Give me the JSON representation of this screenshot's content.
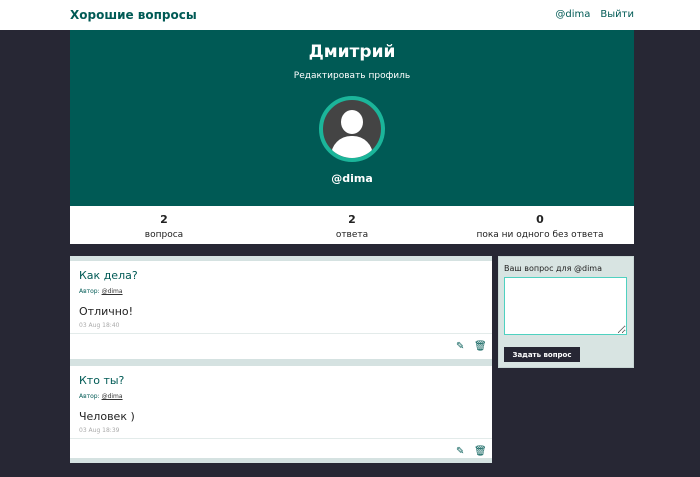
{
  "header": {
    "brand": "Хорошие вопросы",
    "user_link": "@dima",
    "logout": "Выйти"
  },
  "profile": {
    "name": "Дмитрий",
    "edit": "Редактировать профиль",
    "nickname": "@dima"
  },
  "stats": [
    {
      "n": "2",
      "l": "вопроса"
    },
    {
      "n": "2",
      "l": "ответа"
    },
    {
      "n": "0",
      "l": "пока ни одного без ответа"
    }
  ],
  "questions": [
    {
      "title": "Как дела?",
      "author_label": "Автор:",
      "author": "@dima",
      "answer": "Отлично!",
      "date": "03 Aug 18:40"
    },
    {
      "title": "Кто ты?",
      "author_label": "Автор:",
      "author": "@dima",
      "answer": "Человек )",
      "date": "03 Aug 18:39"
    }
  ],
  "ask": {
    "label": "Ваш вопрос для @dima",
    "button": "Задать вопрос"
  }
}
